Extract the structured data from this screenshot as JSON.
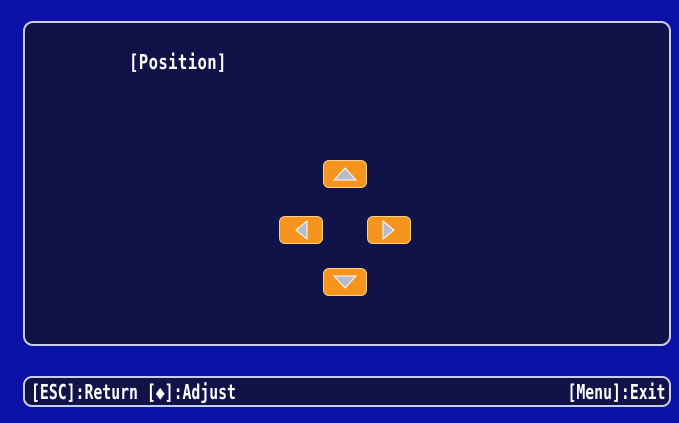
{
  "panel": {
    "title": "[Position]"
  },
  "arrows": {
    "up": "up-arrow",
    "left": "left-arrow",
    "right": "right-arrow",
    "down": "down-arrow"
  },
  "footer": {
    "esc_key": "[ESC]",
    "return_label": ":Return",
    "adjust_open": "[",
    "adjust_symbol": "◆",
    "adjust_close": "]",
    "adjust_label": ":Adjust",
    "menu_key": "[Menu]",
    "exit_label": ":Exit"
  },
  "colors": {
    "background": "#0c11a8",
    "panel": "#111247",
    "border": "#c9cde8",
    "button": "#f5951e",
    "text": "#ffffff"
  }
}
